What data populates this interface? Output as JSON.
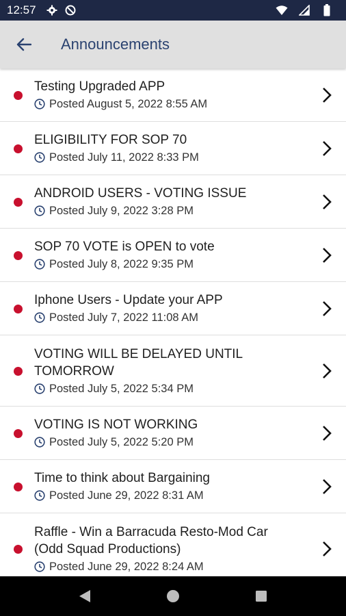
{
  "status_bar": {
    "time": "12:57",
    "icons_left": [
      "settings-gear-icon",
      "do-not-disturb-icon"
    ],
    "icons_right": [
      "wifi-icon",
      "cell-signal-icon",
      "battery-icon"
    ]
  },
  "app_bar": {
    "title": "Announcements",
    "back_icon": "arrow-left-icon"
  },
  "colors": {
    "status_bar": "#1e2845",
    "app_bar": "#e0e0e0",
    "title": "#2a4270",
    "unread_dot": "#c8102e"
  },
  "announcements": [
    {
      "title": "Testing Upgraded APP",
      "posted": "Posted August 5, 2022 8:55 AM",
      "unread": true
    },
    {
      "title": "ELIGIBILITY FOR SOP 70",
      "posted": "Posted July 11, 2022 8:33 PM",
      "unread": true
    },
    {
      "title": "ANDROID USERS - VOTING ISSUE",
      "posted": "Posted July 9, 2022 3:28 PM",
      "unread": true
    },
    {
      "title": "SOP 70 VOTE is OPEN to vote",
      "posted": "Posted July 8, 2022 9:35 PM",
      "unread": true
    },
    {
      "title": "Iphone Users - Update your APP",
      "posted": "Posted July 7, 2022 11:08 AM",
      "unread": true
    },
    {
      "title": "VOTING WILL BE DELAYED UNTIL TOMORROW",
      "posted": "Posted July 5, 2022 5:34 PM",
      "unread": true
    },
    {
      "title": "VOTING IS NOT WORKING",
      "posted": "Posted July 5, 2022 5:20 PM",
      "unread": true
    },
    {
      "title": "Time to think about Bargaining",
      "posted": "Posted June 29, 2022 8:31 AM",
      "unread": true
    },
    {
      "title": "Raffle - Win a Barracuda Resto-Mod Car (Odd Squad Productions)",
      "posted": "Posted June 29, 2022 8:24 AM",
      "unread": true
    }
  ],
  "nav_bar": {
    "buttons": [
      "back-triangle-icon",
      "home-circle-icon",
      "recents-square-icon"
    ]
  }
}
